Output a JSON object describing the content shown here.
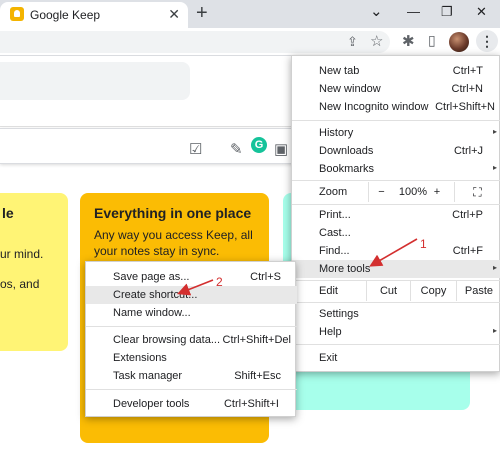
{
  "tab": {
    "title": "Google Keep",
    "close": "✕"
  },
  "window": {
    "new_tab": "+",
    "minimize": "—",
    "chevron": "⌄",
    "restore": "❐",
    "close": "✕"
  },
  "toolbar": {
    "share": "⇪",
    "star": "☆",
    "extensions": "✱",
    "sidebar": "▯",
    "menu": "⋮"
  },
  "note_tools": {
    "checkbox": "☑",
    "brush": "✎",
    "grammarly": "G",
    "image": "▣"
  },
  "cards": {
    "left_lines": [
      "le",
      "ur mind.",
      "os, and"
    ],
    "middle": {
      "title": "Everything in one place",
      "body": [
        "Any way you access Keep, all",
        "your notes stay in sync."
      ]
    }
  },
  "chrome_menu": {
    "new_tab": {
      "label": "New tab",
      "shortcut": "Ctrl+T"
    },
    "new_window": {
      "label": "New window",
      "shortcut": "Ctrl+N"
    },
    "new_incognito": {
      "label": "New Incognito window",
      "shortcut": "Ctrl+Shift+N"
    },
    "history": {
      "label": "History",
      "arrow": "▸"
    },
    "downloads": {
      "label": "Downloads",
      "shortcut": "Ctrl+J"
    },
    "bookmarks": {
      "label": "Bookmarks",
      "arrow": "▸"
    },
    "zoom": {
      "label": "Zoom",
      "minus": "−",
      "value": "100%",
      "plus": "+",
      "fullscreen": "⛶"
    },
    "print": {
      "label": "Print...",
      "shortcut": "Ctrl+P"
    },
    "cast": {
      "label": "Cast..."
    },
    "find": {
      "label": "Find...",
      "shortcut": "Ctrl+F"
    },
    "more_tools": {
      "label": "More tools",
      "arrow": "▸"
    },
    "edit": {
      "label": "Edit",
      "cut": "Cut",
      "copy": "Copy",
      "paste": "Paste"
    },
    "settings": {
      "label": "Settings"
    },
    "help": {
      "label": "Help",
      "arrow": "▸"
    },
    "exit": {
      "label": "Exit"
    }
  },
  "more_tools_menu": {
    "save_page": {
      "label": "Save page as...",
      "shortcut": "Ctrl+S"
    },
    "create_shortcut": {
      "label": "Create shortcut..."
    },
    "name_window": {
      "label": "Name window..."
    },
    "clear_browsing": {
      "label": "Clear browsing data...",
      "shortcut": "Ctrl+Shift+Del"
    },
    "extensions": {
      "label": "Extensions"
    },
    "task_manager": {
      "label": "Task manager",
      "shortcut": "Shift+Esc"
    },
    "developer_tools": {
      "label": "Developer tools",
      "shortcut": "Ctrl+Shift+I"
    }
  },
  "annotations": {
    "step1": "1",
    "step2": "2"
  },
  "colors": {
    "annotation": "#d32f2f",
    "keep_yellow": "#fbbc04",
    "note_yellow": "#fff475",
    "note_teal": "#a7ffeb",
    "grammarly": "#15c39a"
  }
}
